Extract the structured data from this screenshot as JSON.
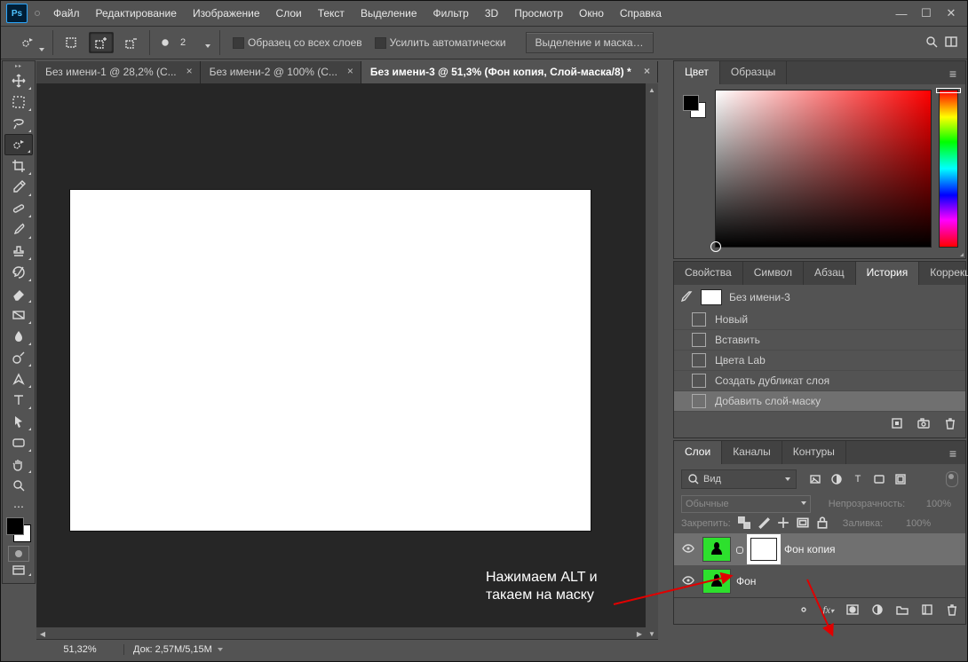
{
  "menu": {
    "items": [
      "Файл",
      "Редактирование",
      "Изображение",
      "Слои",
      "Текст",
      "Выделение",
      "Фильтр",
      "3D",
      "Просмотр",
      "Окно",
      "Справка"
    ]
  },
  "options": {
    "radius_label": "2",
    "sample_all_label": "Образец со всех слоев",
    "enhance_edge_label": "Усилить автоматически",
    "select_mask_label": "Выделение и маска…"
  },
  "tabs": [
    {
      "label": "Без имени-1 @ 28,2% (С...",
      "active": false
    },
    {
      "label": "Без имени-2 @ 100% (С...",
      "active": false
    },
    {
      "label": "Без имени-3 @ 51,3% (Фон копия, Слой-маска/8) *",
      "active": true
    }
  ],
  "status": {
    "zoom": "51,32%",
    "doc_info": "Док: 2,57M/5,15M"
  },
  "color_panel": {
    "tabs": [
      "Цвет",
      "Образцы"
    ]
  },
  "prop_panel": {
    "tabs": [
      "Свойства",
      "Символ",
      "Абзац",
      "История",
      "Коррекция"
    ],
    "doc_name": "Без имени-3",
    "history": [
      {
        "label": "Новый"
      },
      {
        "label": "Вставить"
      },
      {
        "label": "Цвета Lab"
      },
      {
        "label": "Создать дубликат слоя"
      },
      {
        "label": "Добавить слой-маску"
      }
    ]
  },
  "layers_panel": {
    "tabs": [
      "Слои",
      "Каналы",
      "Контуры"
    ],
    "filter_kind": "Вид",
    "blend_mode": "Обычные",
    "opacity_label": "Непрозрачность:",
    "opacity_value": "100%",
    "fill_label": "Заливка:",
    "fill_value": "100%",
    "lock_label": "Закрепить:",
    "layers": [
      {
        "name": "Фон копия",
        "visible": true,
        "hasMask": true,
        "selected": true
      },
      {
        "name": "Фон",
        "visible": true,
        "hasMask": false,
        "selected": false
      }
    ]
  },
  "annotation": {
    "line1": "Нажимаем ALT и",
    "line2": "такаем на маску"
  }
}
